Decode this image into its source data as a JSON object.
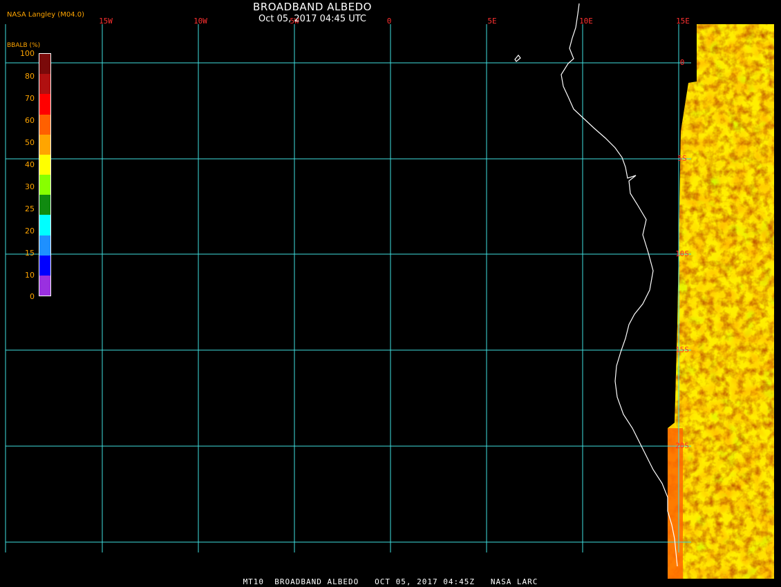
{
  "header": {
    "title": "BROADBAND ALBEDO",
    "subtitle": "Oct 05, 2017 04:45 UTC",
    "credit": "NASA Langley (M04.0)"
  },
  "legend": {
    "label": "BBALB (%)",
    "ticks": [
      "100",
      "80",
      "70",
      "60",
      "50",
      "40",
      "30",
      "25",
      "20",
      "15",
      "10",
      "0"
    ],
    "colors": [
      "#7a0a0a",
      "#b01010",
      "#ff0000",
      "#ff6000",
      "#ffa500",
      "#ffff00",
      "#88ff00",
      "#108a10",
      "#00ffff",
      "#1e90ff",
      "#0000ff",
      "#9a30e0"
    ]
  },
  "map": {
    "lon_labels": [
      "15W",
      "10W",
      "5W",
      "0",
      "5E",
      "10E",
      "15E"
    ],
    "lat_labels": [
      "0",
      "5S",
      "10S",
      "15S",
      "20S"
    ],
    "grid_color": "#40e0e0",
    "label_color": "#ff3030",
    "coastline_color": "#ffffff"
  },
  "footer": {
    "caption": "MT10  BROADBAND ALBEDO   OCT 05, 2017 04:45Z   NASA LARC"
  }
}
